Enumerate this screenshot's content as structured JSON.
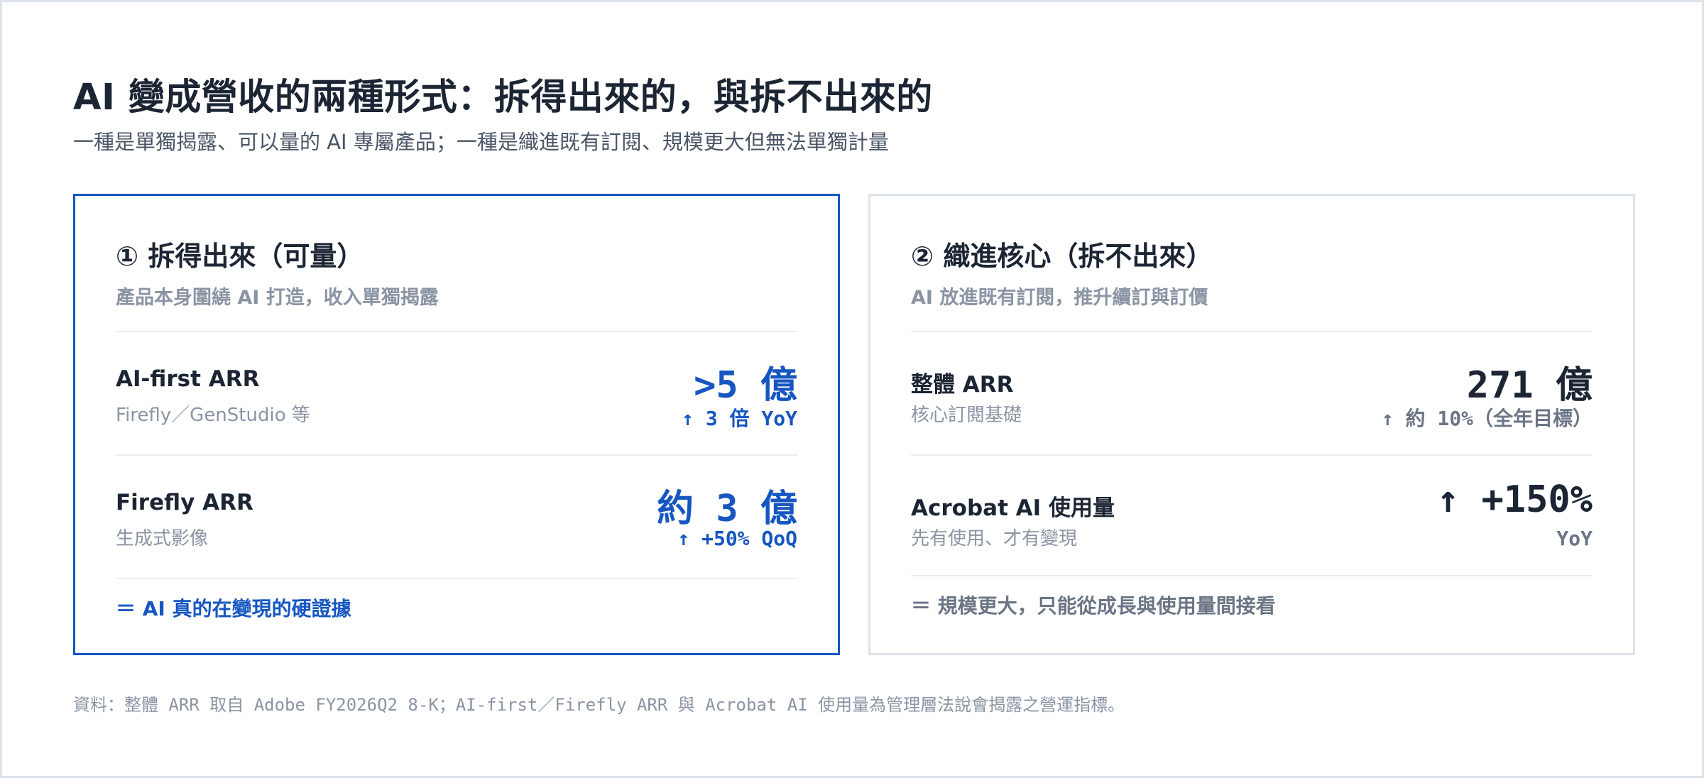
{
  "header": {
    "title": "AI 變成營收的兩種形式：拆得出來的，與拆不出來的",
    "subtitle": "一種是單獨揭露、可以量的 AI 專屬產品；一種是織進既有訂閱、規模更大但無法單獨計量"
  },
  "cards": [
    {
      "title": "① 拆得出來（可量）",
      "subtitle": "產品本身圍繞 AI 打造，收入單獨揭露",
      "metrics": [
        {
          "name": "AI-first ARR",
          "desc": "Firefly／GenStudio 等",
          "value": ">5 億",
          "change": "↑ 3 倍 YoY"
        },
        {
          "name": "Firefly ARR",
          "desc": "生成式影像",
          "value": "約 3 億",
          "change": "↑ +50% QoQ"
        }
      ],
      "footer": "＝ AI 真的在變現的硬證據"
    },
    {
      "title": "② 織進核心（拆不出來）",
      "subtitle": "AI 放進既有訂閱，推升續訂與訂價",
      "metrics": [
        {
          "name": "整體 ARR",
          "desc": "核心訂閱基礎",
          "value": "271 億",
          "change": "↑ 約 10%（全年目標）"
        },
        {
          "name": "Acrobat AI 使用量",
          "desc": "先有使用、才有變現",
          "value": "↑ +150%",
          "change": "YoY"
        }
      ],
      "footer": "＝ 規模更大，只能從成長與使用量間接看"
    }
  ],
  "source": "資料：整體 ARR 取自 Adobe FY2026Q2 8-K；AI-first／Firefly ARR 與 Acrobat AI 使用量為管理層法說會揭露之營運指標。",
  "colors": {
    "accent": "#1656c1",
    "text": "#1c2533",
    "muted": "#8a94a3",
    "border": "#dde3eb"
  }
}
